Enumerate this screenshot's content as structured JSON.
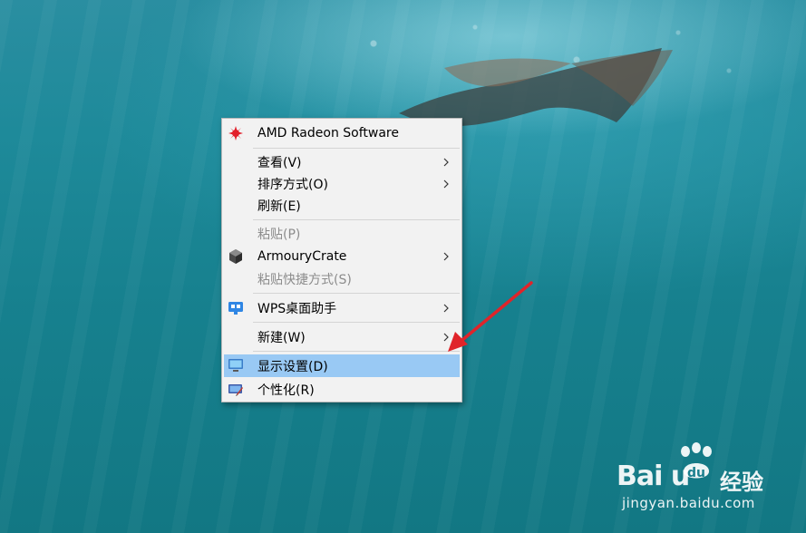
{
  "context_menu": {
    "items": [
      {
        "label": "AMD Radeon Software",
        "icon": "amd-radeon-icon"
      },
      {
        "label": "查看(V)",
        "submenu": true
      },
      {
        "label": "排序方式(O)",
        "submenu": true
      },
      {
        "label": "刷新(E)"
      },
      {
        "label": "粘贴(P)",
        "disabled": true
      },
      {
        "label": "ArmouryCrate",
        "icon": "armoury-crate-icon",
        "submenu": true
      },
      {
        "label": "粘贴快捷方式(S)",
        "disabled": true
      },
      {
        "label": "WPS桌面助手",
        "icon": "wps-desktop-icon",
        "submenu": true
      },
      {
        "label": "新建(W)",
        "submenu": true
      },
      {
        "label": "显示设置(D)",
        "icon": "display-settings-icon",
        "highlighted": true
      },
      {
        "label": "个性化(R)",
        "icon": "personalize-icon"
      }
    ],
    "highlight_color": "#99c9f4"
  },
  "annotation": {
    "color": "#e0242a",
    "icon": "red-pointer-arrow"
  },
  "watermark": {
    "brand": "Bai  u",
    "cn": "经验",
    "url": "jingyan.baidu.com"
  }
}
